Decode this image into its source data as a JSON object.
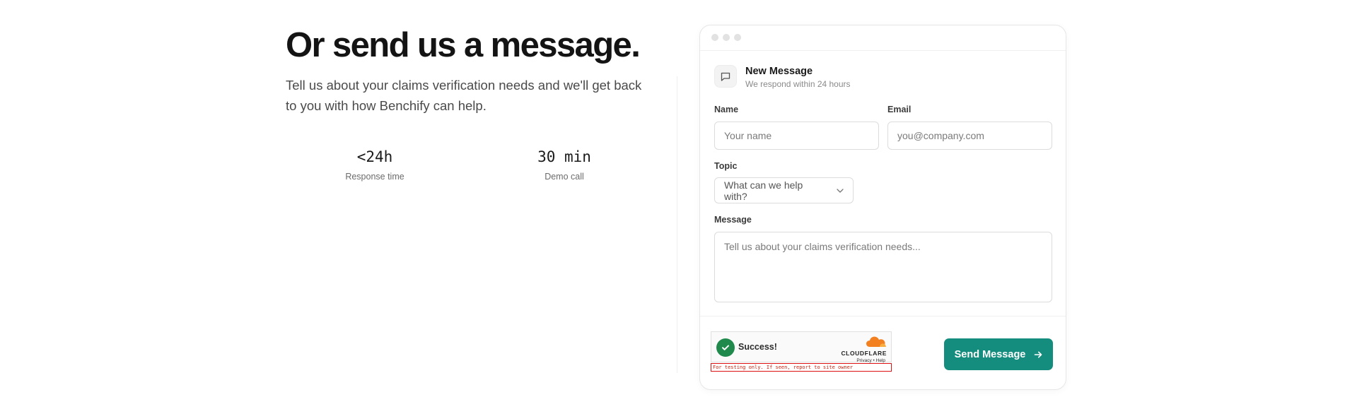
{
  "hero": {
    "headline": "Or send us a message.",
    "subtext": "Tell us about your claims verification needs and we'll get back to you with how Benchify can help."
  },
  "stats": [
    {
      "value": "<24h",
      "label": "Response time"
    },
    {
      "value": "30 min",
      "label": "Demo call"
    }
  ],
  "form": {
    "header": {
      "title": "New Message",
      "subtitle": "We respond within 24 hours"
    },
    "name": {
      "label": "Name",
      "placeholder": "Your name",
      "value": ""
    },
    "email": {
      "label": "Email",
      "placeholder": "you@company.com",
      "value": ""
    },
    "topic": {
      "label": "Topic",
      "selected": "What can we help with?"
    },
    "message": {
      "label": "Message",
      "placeholder": "Tell us about your claims verification needs...",
      "value": ""
    },
    "captcha": {
      "status": "Success!",
      "brand": "CLOUDFLARE",
      "links": "Privacy • Help",
      "warning": "For testing only. If seen, report to site owner"
    },
    "submit_label": "Send Message"
  },
  "icons": {
    "message": "chat-bubble-icon",
    "chevron": "chevron-down-icon",
    "arrow": "arrow-right-icon",
    "check": "check-icon",
    "cloud": "cloudflare-cloud-icon"
  },
  "colors": {
    "accent": "#148c7e",
    "success": "#1f8a4c",
    "cloudflare": "#f38020"
  }
}
